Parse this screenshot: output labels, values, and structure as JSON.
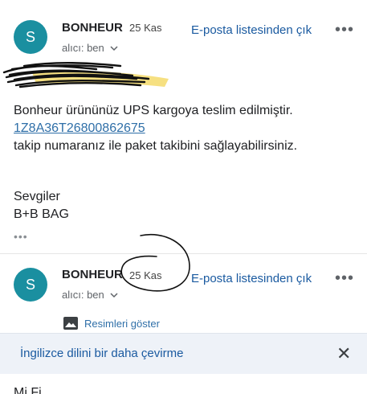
{
  "messages": [
    {
      "avatar_letter": "S",
      "sender": "BONHEUR",
      "date": "25 Kas",
      "unsubscribe": "E-posta listesinden çık",
      "more": "•••",
      "recipient": "alıcı: ben",
      "body": {
        "line1": "Bonheur ürününüz UPS kargoya teslim edilmiştir.",
        "tracking": "1Z8A36T26800862675",
        "line2": "takip numaranız ile paket takibini sağlayabilirsiniz.",
        "closing": "Sevgiler",
        "signature": "B+B BAG"
      },
      "quoted_toggle": "•••"
    },
    {
      "avatar_letter": "S",
      "sender": "BONHEUR",
      "date": "25 Kas",
      "unsubscribe": "E-posta listesinden çık",
      "more": "•••",
      "recipient": "alıcı: ben",
      "show_images": "Resimleri göster"
    }
  ],
  "translate_bar": {
    "text": "İngilizce dilini bir daha çevirme",
    "close": "✕"
  },
  "bottom_partial_text": "Mi Fi..."
}
